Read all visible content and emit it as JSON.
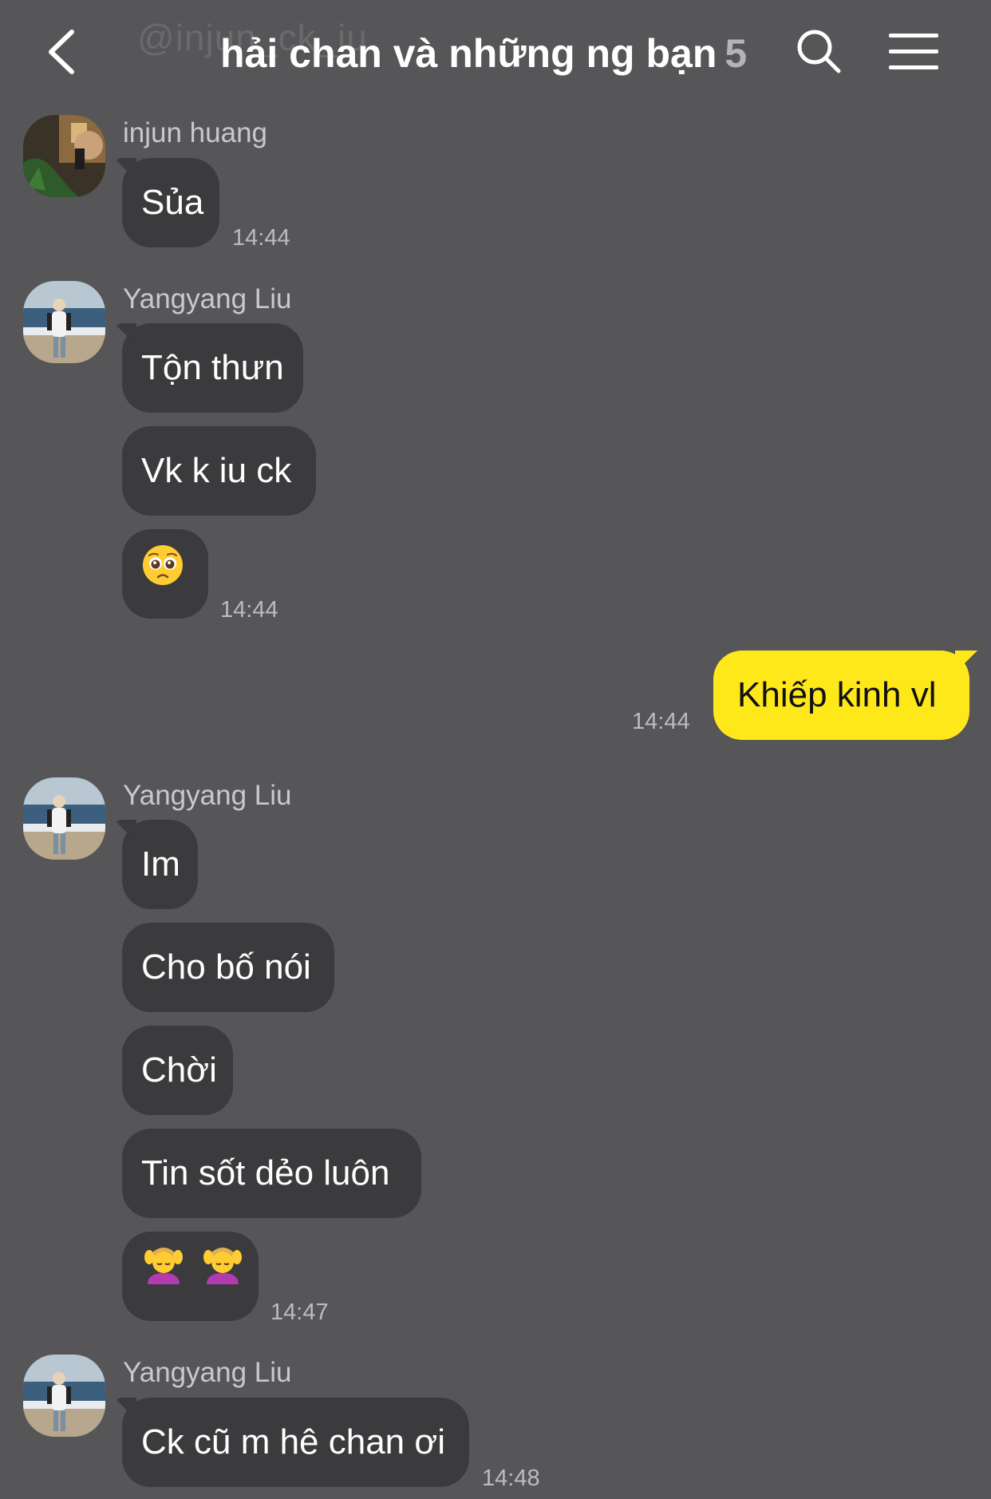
{
  "header": {
    "watermark": "@injun_ck_iu",
    "title": "hải chan và những ng bạn",
    "member_count": "5",
    "back_icon": "chevron-left-icon",
    "search_icon": "search-icon",
    "menu_icon": "hamburger-menu-icon"
  },
  "colors": {
    "background": "#565557",
    "incoming_bubble": "#3b3a3d",
    "outgoing_bubble": "#ffe81a"
  },
  "messages": [
    {
      "sender": "injun huang",
      "texts": [
        "Sủa"
      ],
      "time": "14:44"
    },
    {
      "sender": "Yangyang Liu",
      "texts": [
        "Tộn thưn",
        "Vk k iu ck",
        "🥹"
      ],
      "time": "14:44"
    },
    {
      "sender": "me",
      "texts": [
        "Khiếp kinh vl"
      ],
      "time": "14:44"
    },
    {
      "sender": "Yangyang Liu",
      "texts": [
        "Im",
        "Cho bố nói",
        "Chời",
        "Tin sốt dẻo luôn",
        "💆‍♀️💆‍♀️"
      ],
      "time": "14:47"
    },
    {
      "sender": "Yangyang Liu",
      "texts": [
        "Ck cũ m hê chan ơi"
      ],
      "time": "14:48"
    }
  ]
}
